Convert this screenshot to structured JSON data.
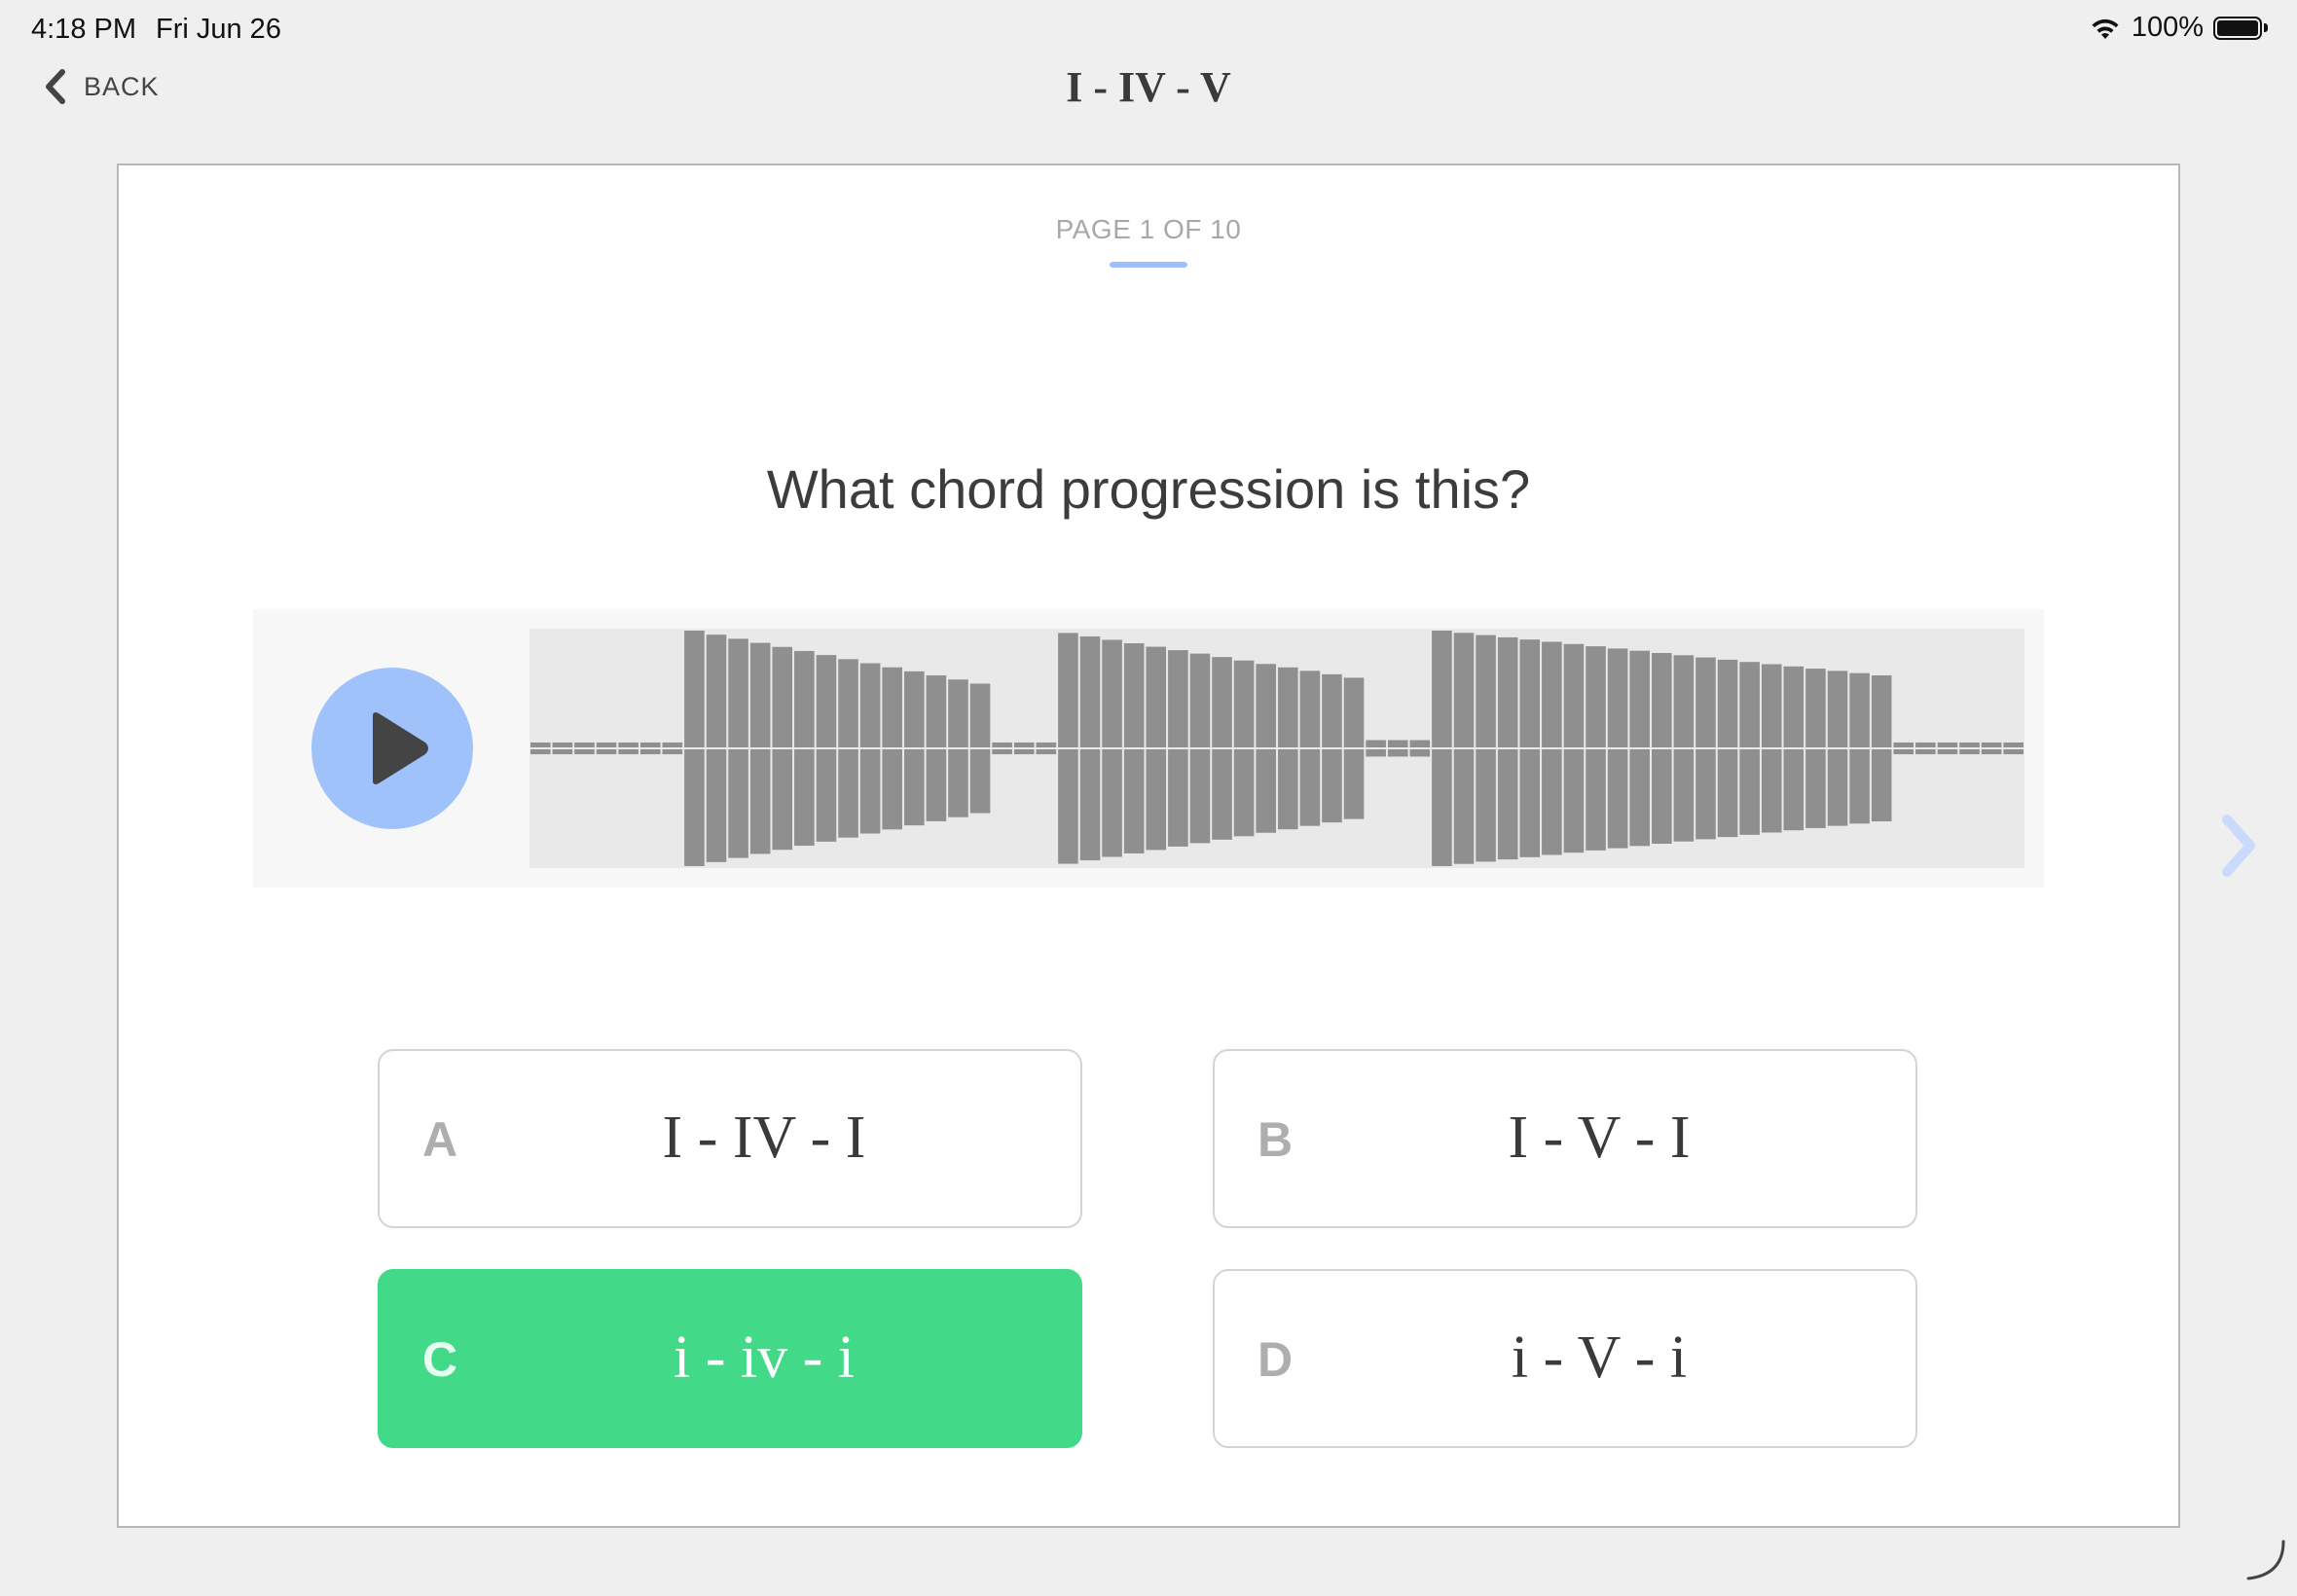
{
  "status_bar": {
    "time": "4:18 PM",
    "date": "Fri Jun 26",
    "battery": "100%",
    "icons": [
      "wifi-icon",
      "battery-icon"
    ]
  },
  "nav": {
    "back_label": "BACK",
    "back_icon": "chevron-left-icon",
    "title": "I - IV - V"
  },
  "quiz": {
    "page_indicator": "PAGE 1 OF 10",
    "question": "What chord progression is this?",
    "player": {
      "play_icon": "play-icon",
      "waveform": {
        "segments": [
          {
            "type": "silence",
            "bars": 7,
            "amp": 0.05
          },
          {
            "type": "chord",
            "bars": 14,
            "start_amp": 1.0,
            "end_amp": 0.55
          },
          {
            "type": "silence",
            "bars": 3,
            "amp": 0.05
          },
          {
            "type": "chord",
            "bars": 14,
            "start_amp": 0.98,
            "end_amp": 0.6
          },
          {
            "type": "silence",
            "bars": 3,
            "amp": 0.07
          },
          {
            "type": "chord",
            "bars": 21,
            "start_amp": 1.0,
            "end_amp": 0.62
          },
          {
            "type": "silence",
            "bars": 6,
            "amp": 0.05
          }
        ]
      }
    },
    "answers": [
      {
        "letter": "A",
        "text": "I - IV - I",
        "selected": false
      },
      {
        "letter": "B",
        "text": "I - V - I",
        "selected": false
      },
      {
        "letter": "C",
        "text": "i - iv - i",
        "selected": true
      },
      {
        "letter": "D",
        "text": "i - V - i",
        "selected": false
      }
    ],
    "next_icon": "chevron-right-icon"
  },
  "colors": {
    "accent_blue": "#a0c2fb",
    "selected_green": "#42d989",
    "waveform_bar": "#8f8f8f"
  }
}
